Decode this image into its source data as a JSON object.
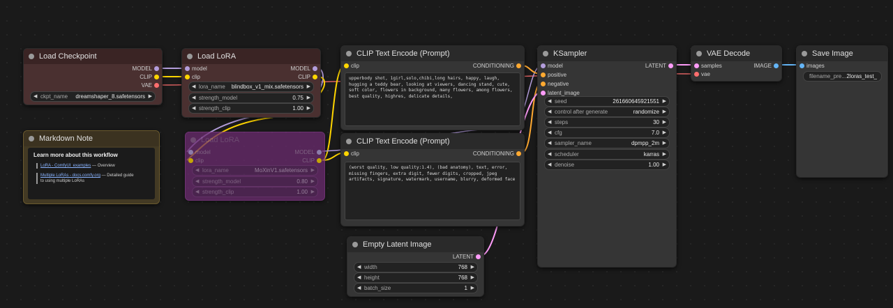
{
  "colors": {
    "model": "#b39ddb",
    "clip": "#ffd500",
    "vae": "#ff6e6e",
    "conditioning": "#ffa931",
    "latent": "#ff9cf9",
    "image": "#64b5f6"
  },
  "nodes": {
    "load_checkpoint": {
      "title": "Load Checkpoint",
      "outputs": [
        "MODEL",
        "CLIP",
        "VAE"
      ],
      "ckpt_label": "ckpt_name",
      "ckpt_value": "dreamshaper_8.safetensors"
    },
    "load_lora": {
      "title": "Load LoRA",
      "inputs": [
        "model",
        "clip"
      ],
      "outputs": [
        "MODEL",
        "CLIP"
      ],
      "widgets": [
        {
          "label": "lora_name",
          "value": "blindbox_v1_mix.safetensors"
        },
        {
          "label": "strength_model",
          "value": "0.75"
        },
        {
          "label": "strength_clip",
          "value": "1.00"
        }
      ]
    },
    "load_lora_bypassed": {
      "title": "Load LoRA",
      "inputs": [
        "model",
        "clip"
      ],
      "outputs": [
        "MODEL",
        "CLIP"
      ],
      "widgets": [
        {
          "label": "lora_name",
          "value": "MoXinV1.safetensors"
        },
        {
          "label": "strength_model",
          "value": "0.80"
        },
        {
          "label": "strength_clip",
          "value": "1.00"
        }
      ]
    },
    "markdown_note": {
      "title": "Markdown Note",
      "heading": "Learn more about this workflow",
      "links": [
        {
          "link": "LoRA - ComfyUI_examples",
          "rest": " — Overview"
        },
        {
          "link": "Multiple LoRAs - docs.comfy.org",
          "rest": " — Detailed guide to using multiple LoRAs"
        }
      ]
    },
    "clip_pos": {
      "title": "CLIP Text Encode (Prompt)",
      "input": "clip",
      "output": "CONDITIONING",
      "text": "upperbody shot, 1girl,solo,chibi,long hairs, happy, laugh, hugging a teddy bear, looking at viewers, dancing stand, cute, soft color, flowers in background, many flowers, among flowers, best quality, highres, delicate details,"
    },
    "clip_neg": {
      "title": "CLIP Text Encode (Prompt)",
      "input": "clip",
      "output": "CONDITIONING",
      "text": "(worst quality, low quality:1.4), (bad anatomy), text, error, missing fingers, extra digit, fewer digits, cropped, jpeg artifacts, signature, watermark, username, blurry, deformed face"
    },
    "empty_latent": {
      "title": "Empty Latent Image",
      "output": "LATENT",
      "widgets": [
        {
          "label": "width",
          "value": "768"
        },
        {
          "label": "height",
          "value": "768"
        },
        {
          "label": "batch_size",
          "value": "1"
        }
      ]
    },
    "ksampler": {
      "title": "KSampler",
      "inputs": [
        "model",
        "positive",
        "negative",
        "latent_image"
      ],
      "output": "LATENT",
      "widgets": [
        {
          "label": "seed",
          "value": "261660645921551"
        },
        {
          "label": "control after generate",
          "value": "randomize"
        },
        {
          "label": "steps",
          "value": "30"
        },
        {
          "label": "cfg",
          "value": "7.0"
        },
        {
          "label": "sampler_name",
          "value": "dpmpp_2m"
        },
        {
          "label": "scheduler",
          "value": "karras"
        },
        {
          "label": "denoise",
          "value": "1.00"
        }
      ]
    },
    "vae_decode": {
      "title": "VAE Decode",
      "inputs": [
        "samples",
        "vae"
      ],
      "output": "IMAGE"
    },
    "save_image": {
      "title": "Save Image",
      "input": "images",
      "widget": {
        "label": "filename_pre...",
        "value": "2loras_test_"
      }
    }
  }
}
